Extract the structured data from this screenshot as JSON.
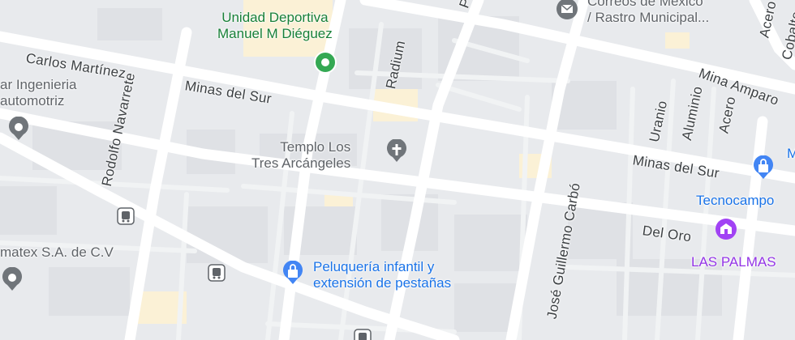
{
  "streets": {
    "carlos_martinez": "Carlos Martínez",
    "minas_del_sur_west": "Minas del Sur",
    "minas_del_sur_east": "Minas del Sur",
    "rodolfo_navarrete": "Rodolfo Navarrete",
    "radium": "Radium",
    "jose_guillermo_carbo": "José Guillermo Carbó",
    "del_oro": "Del Oro",
    "uranio": "Uranio",
    "aluminio": "Aluminio",
    "acero_1": "Acero",
    "acero_2": "Acero",
    "mina_amparo": "Mina Amparo",
    "cobalto": "Cobalto",
    "p_partial": "P"
  },
  "places": {
    "unidad_deportiva": [
      "Unidad Deportiva",
      "Manuel M Diéguez"
    ],
    "templo": [
      "Templo Los",
      "Tres Arcángeles"
    ],
    "correos": [
      "Correos de México",
      "/ Rastro Municipal..."
    ],
    "ingenieria": [
      "ar Ingenieria",
      "automotriz"
    ],
    "matex": "matex S.A. de C.V",
    "peluqueria": [
      "Peluquería infantil y",
      "extensión de pestañas"
    ],
    "tecnocampo": "Tecnocampo",
    "las_palmas": "LAS PALMAS",
    "m_partial": "M"
  },
  "icons": {
    "sports_pin": "green-park-pin",
    "church_pin": "cross-icon",
    "post_pin": "mail-icon",
    "shop_pins": "shopping-bag-icon",
    "school_pin": "school-icon",
    "bus_stops": "bus-icon",
    "generic_pins": "place-icon"
  },
  "colors": {
    "block": "#e8eaed",
    "road": "#ffffff",
    "building": "#dadce0",
    "park": "#fdf3d7",
    "green_pin": "#34a853",
    "gray_pin": "#70757a",
    "blue_pin": "#4285f4",
    "purple_pin": "#a142f4"
  }
}
